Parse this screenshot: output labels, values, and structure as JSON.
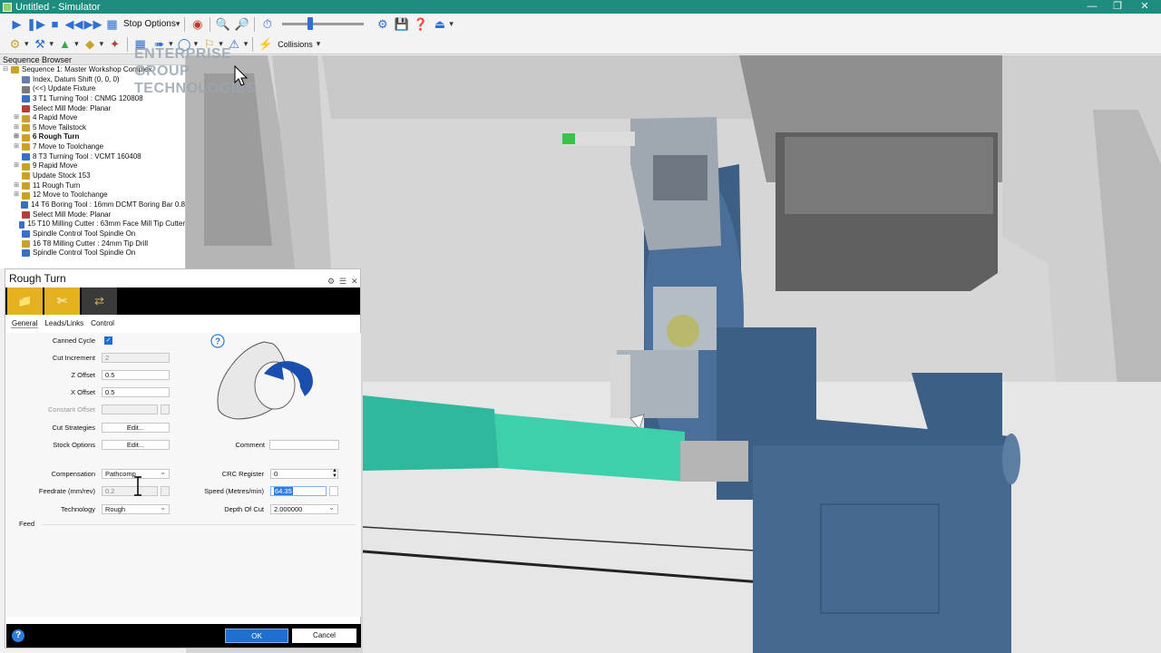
{
  "window": {
    "title": "Untitled - Simulator",
    "minimize": "—",
    "restore": "❐",
    "close": "✕"
  },
  "toolbar": {
    "stop_options": "Stop Options",
    "collisions": "Collisions"
  },
  "sequence_browser": {
    "title": "Sequence Browser",
    "items": [
      {
        "label": "Sequence 1: Master Workshop Complex",
        "exp": "⊟",
        "color": "#c9a227",
        "bold": false
      },
      {
        "label": "Index, Datum Shift (0, 0, 0)",
        "exp": "",
        "color": "#6a7fa8",
        "bold": false
      },
      {
        "label": "(<<) Update Fixture",
        "exp": "",
        "color": "#7a7a7a",
        "bold": false
      },
      {
        "label": "3 T1 Turning Tool : CNMG 120808",
        "exp": "",
        "color": "#3b6fc4",
        "bold": false
      },
      {
        "label": "Select Mill Mode: Planar",
        "exp": "",
        "color": "#b0413e",
        "bold": false
      },
      {
        "label": "4 Rapid Move",
        "exp": "⊞",
        "color": "#c9a227",
        "bold": false
      },
      {
        "label": "5 Move Tailstock",
        "exp": "⊞",
        "color": "#c9a227",
        "bold": false
      },
      {
        "label": "6 Rough Turn",
        "exp": "⊞",
        "color": "#c9a227",
        "bold": true
      },
      {
        "label": "7 Move to Toolchange",
        "exp": "⊞",
        "color": "#c9a227",
        "bold": false
      },
      {
        "label": "8 T3 Turning Tool : VCMT 160408",
        "exp": "",
        "color": "#3b6fc4",
        "bold": false
      },
      {
        "label": "9 Rapid Move",
        "exp": "⊞",
        "color": "#c9a227",
        "bold": false
      },
      {
        "label": "Update Stock 153",
        "exp": "",
        "color": "#c9a227",
        "bold": false
      },
      {
        "label": "11 Rough Turn",
        "exp": "⊞",
        "color": "#c9a227",
        "bold": false
      },
      {
        "label": "12 Move to Toolchange",
        "exp": "⊞",
        "color": "#c9a227",
        "bold": false
      },
      {
        "label": "14 T6 Boring Tool : 16mm DCMT Boring Bar 0.8",
        "exp": "",
        "color": "#3b6fc4",
        "bold": false
      },
      {
        "label": "Select Mill Mode: Planar",
        "exp": "",
        "color": "#b0413e",
        "bold": false
      },
      {
        "label": "15 T10 Milling Cutter : 63mm Face Mill Tip Cutter",
        "exp": "",
        "color": "#3b6fc4",
        "bold": false
      },
      {
        "label": "Spindle Control Tool Spindle On",
        "exp": "",
        "color": "#3b6fc4",
        "bold": false
      },
      {
        "label": "16 T8 Milling Cutter : 24mm Tip Drill",
        "exp": "",
        "color": "#c9a227",
        "bold": false
      },
      {
        "label": "Spindle Control Tool Spindle On",
        "exp": "",
        "color": "#3b6fc4",
        "bold": false
      }
    ]
  },
  "watermark": {
    "line1": "ENTERPRISE",
    "line2": "GROUP",
    "line3": "TECHNOLOGIES"
  },
  "dialog": {
    "title": "Rough Turn",
    "tabs": [
      "General",
      "Leads/Links",
      "Control"
    ],
    "fields": {
      "canned_cycle": "Canned Cycle",
      "cut_increment": {
        "label": "Cut Increment",
        "value": "2"
      },
      "z_offset": {
        "label": "Z Offset",
        "value": "0.5"
      },
      "x_offset": {
        "label": "X Offset",
        "value": "0.5"
      },
      "constant_offset": {
        "label": "Constant Offset",
        "value": ""
      },
      "cut_strategies": {
        "label": "Cut Strategies",
        "button": "Edit..."
      },
      "stock_options": {
        "label": "Stock Options",
        "button": "Edit..."
      },
      "comment": {
        "label": "Comment",
        "value": ""
      }
    },
    "feed_section": "Feed",
    "feed": {
      "compensation": {
        "label": "Compensation",
        "value": "Pathcomp"
      },
      "feedrate": {
        "label": "Feedrate (mm/rev)",
        "value": "0.2"
      },
      "technology": {
        "label": "Technology",
        "value": "Rough"
      },
      "crc_register": {
        "label": "CRC Register",
        "value": "0"
      },
      "speed": {
        "label": "Speed (Metres/min)",
        "value": "64.35"
      },
      "depth_of_cut": {
        "label": "Depth Of Cut",
        "value": "2.000000"
      }
    },
    "ok": "OK",
    "cancel": "Cancel"
  },
  "colors": {
    "titlebar": "#1f8c80",
    "accent": "#1f6fd0",
    "stock": "#39c9a8",
    "machine_blue": "#3d5e85"
  }
}
